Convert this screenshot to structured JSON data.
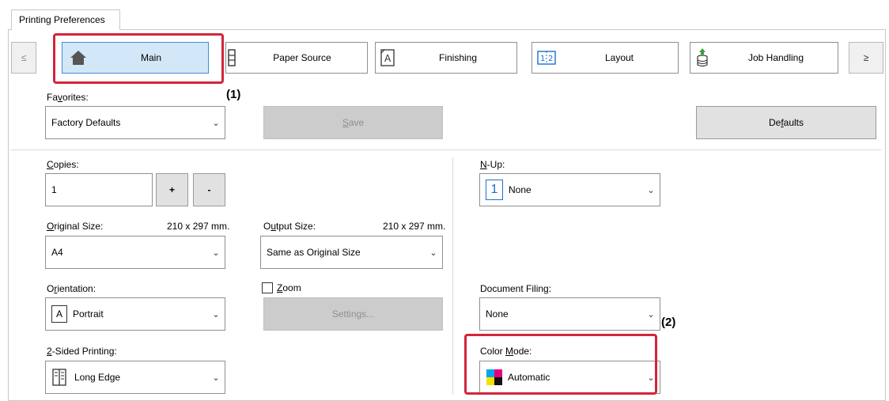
{
  "window": {
    "tab_label": "Printing Preferences"
  },
  "nav": {
    "prev": "≤",
    "next": "≥",
    "tabs": [
      {
        "label": "Main",
        "icon": "home-icon"
      },
      {
        "label": "Paper Source",
        "icon": "paper-tray-icon"
      },
      {
        "label": "Finishing",
        "icon": "finishing-icon"
      },
      {
        "label": "Layout",
        "icon": "layout-icon"
      },
      {
        "label": "Job Handling",
        "icon": "job-handling-icon"
      }
    ]
  },
  "favorites": {
    "label_pre": "Fa",
    "label_u": "v",
    "label_post": "orites:",
    "value": "Factory Defaults"
  },
  "save_button": {
    "pre": "",
    "u": "S",
    "post": "ave"
  },
  "defaults_button": {
    "pre": "De",
    "u": "f",
    "post": "aults"
  },
  "copies": {
    "label_pre": "",
    "label_u": "C",
    "label_post": "opies:",
    "value": "1",
    "plus": "+",
    "minus": "-"
  },
  "original_size": {
    "label_pre": "",
    "label_u": "O",
    "label_post": "riginal Size:",
    "dims": "210 x 297 mm.",
    "value": "A4"
  },
  "output_size": {
    "label_pre": "O",
    "label_u": "u",
    "label_post": "tput Size:",
    "dims": "210 x 297 mm.",
    "value": "Same as Original Size"
  },
  "orientation": {
    "label_pre": "O",
    "label_u": "r",
    "label_post": "ientation:",
    "value": "Portrait",
    "icon_glyph": "A"
  },
  "zoom": {
    "pre": "",
    "u": "Z",
    "post": "oom",
    "checked": false
  },
  "settings_button": "Settings...",
  "two_sided": {
    "label_pre": "",
    "label_u": "2",
    "label_post": "-Sided Printing:",
    "value": "Long Edge"
  },
  "nup": {
    "label_pre": "",
    "label_u": "N",
    "label_post": "-Up:",
    "value": "None",
    "icon_glyph": "1"
  },
  "document_filing": {
    "label_pre": "Document Filin",
    "label_u": "g",
    "label_post": ":",
    "value": "None"
  },
  "color_mode": {
    "label_pre": "Color ",
    "label_u": "M",
    "label_post": "ode:",
    "value": "Automatic"
  },
  "annotations": {
    "one": "(1)",
    "two": "(2)"
  },
  "colors": {
    "highlight": "#d3253b",
    "selected_tab": "#d2e7f8",
    "selected_border": "#3d8fd6",
    "home_icon": "#555555",
    "nup_icon": "#1f6fd0"
  }
}
